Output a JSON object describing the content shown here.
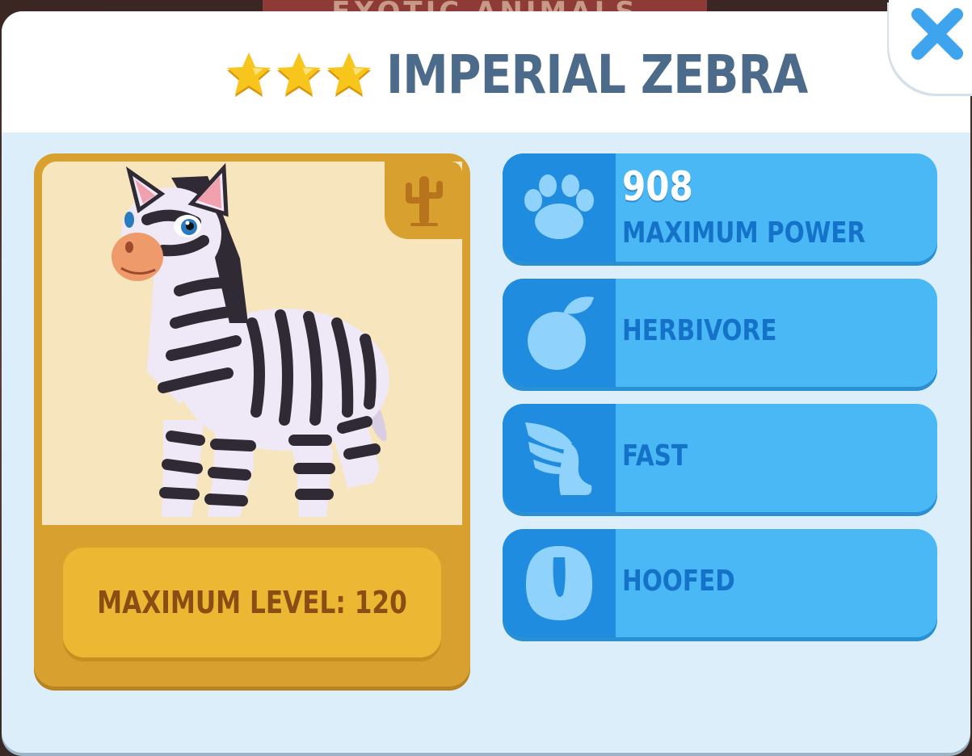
{
  "background": {
    "banner_text": "EXOTIC ANIMALS"
  },
  "header": {
    "star_count": 3,
    "title": "IMPERIAL ZEBRA"
  },
  "close_button": {
    "icon": "close-icon"
  },
  "animal_card": {
    "habitat_icon": "cactus-icon",
    "level_label": "MAXIMUM LEVEL: 120"
  },
  "stats": [
    {
      "icon": "paw-icon",
      "value": "908",
      "label": "MAXIMUM POWER"
    },
    {
      "icon": "fruit-icon",
      "label": "HERBIVORE"
    },
    {
      "icon": "wing-icon",
      "label": "FAST"
    },
    {
      "icon": "hoof-icon",
      "label": "HOOFED"
    }
  ],
  "colors": {
    "title": "#4c6a8a",
    "close": "#3fa4ee",
    "star": "#f7c51b",
    "card": "#d8a12f",
    "level_box": "#ecb834",
    "stat_row": "#4bb8f6",
    "stat_icon_box": "#1f8ce0",
    "stat_label": "#1473c8"
  }
}
